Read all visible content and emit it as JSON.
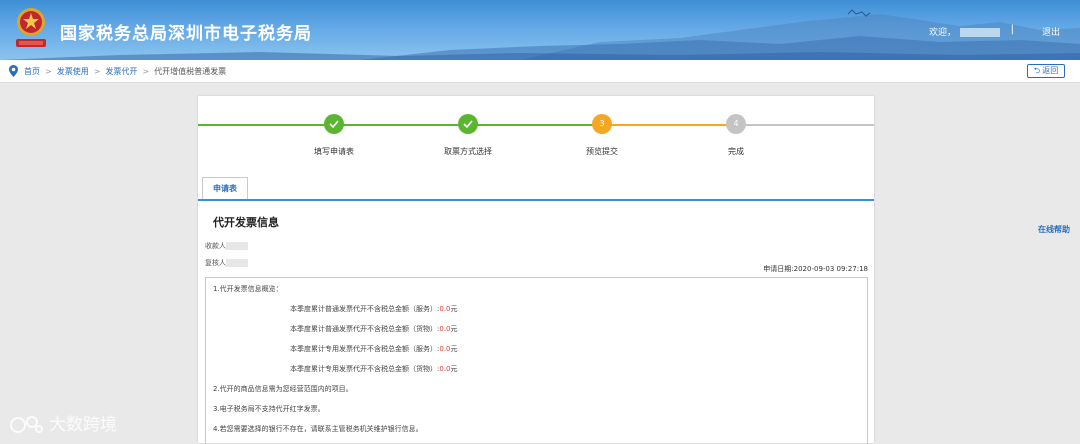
{
  "header": {
    "title": "国家税务总局深圳市电子税务局",
    "welcome": "欢迎，",
    "separator": "|",
    "logout": "退出"
  },
  "breadcrumb": {
    "items": [
      "首页",
      "发票使用",
      "发票代开"
    ],
    "separator": ">",
    "current": "代开增值税普通发票",
    "back": "返回"
  },
  "steps": [
    {
      "label": "填写申请表",
      "state": "done",
      "number": "1"
    },
    {
      "label": "取票方式选择",
      "state": "done",
      "number": "2"
    },
    {
      "label": "预览提交",
      "state": "current",
      "number": "3"
    },
    {
      "label": "完成",
      "state": "pending",
      "number": "4"
    }
  ],
  "colors": {
    "done": "#5cb531",
    "current": "#f5a623",
    "pending": "#c4c4c4",
    "link": "#2a6ebb",
    "amount": "#e53935"
  },
  "tab": {
    "label": "申请表"
  },
  "section": {
    "title": "代开发票信息"
  },
  "fields": {
    "payee": "收款人",
    "reviewer": "复核人"
  },
  "apply_date": "申请日期:2020-09-03 09:27:18",
  "notice": {
    "overview": "1.代开发票信息概览：",
    "quarter_items": [
      {
        "label": "本季度累计普通发票代开不含税总金额（服务）:",
        "amount": "0.0",
        "unit": "元"
      },
      {
        "label": "本季度累计普通发票代开不含税总金额（货物）:",
        "amount": "0.0",
        "unit": "元"
      },
      {
        "label": "本季度累计专用发票代开不含税总金额（服务）:",
        "amount": "0.0",
        "unit": "元"
      },
      {
        "label": "本季度累计专用发票代开不含税总金额（货物）:",
        "amount": "0.0",
        "unit": "元"
      }
    ],
    "line2": "2.代开的商品信息需为您经营范围内的项目。",
    "line3": "3.电子税务局不支持代开红字发票。",
    "line4": "4.若您需要选择的银行不存在，请联系主管税务机关维护银行信息。"
  },
  "help": "在线帮助",
  "watermark": "大数跨境",
  "icons": {
    "pin": "location-pin-icon",
    "back": "back-arrow-icon",
    "check": "check-icon",
    "emblem": "tax-emblem-icon"
  }
}
